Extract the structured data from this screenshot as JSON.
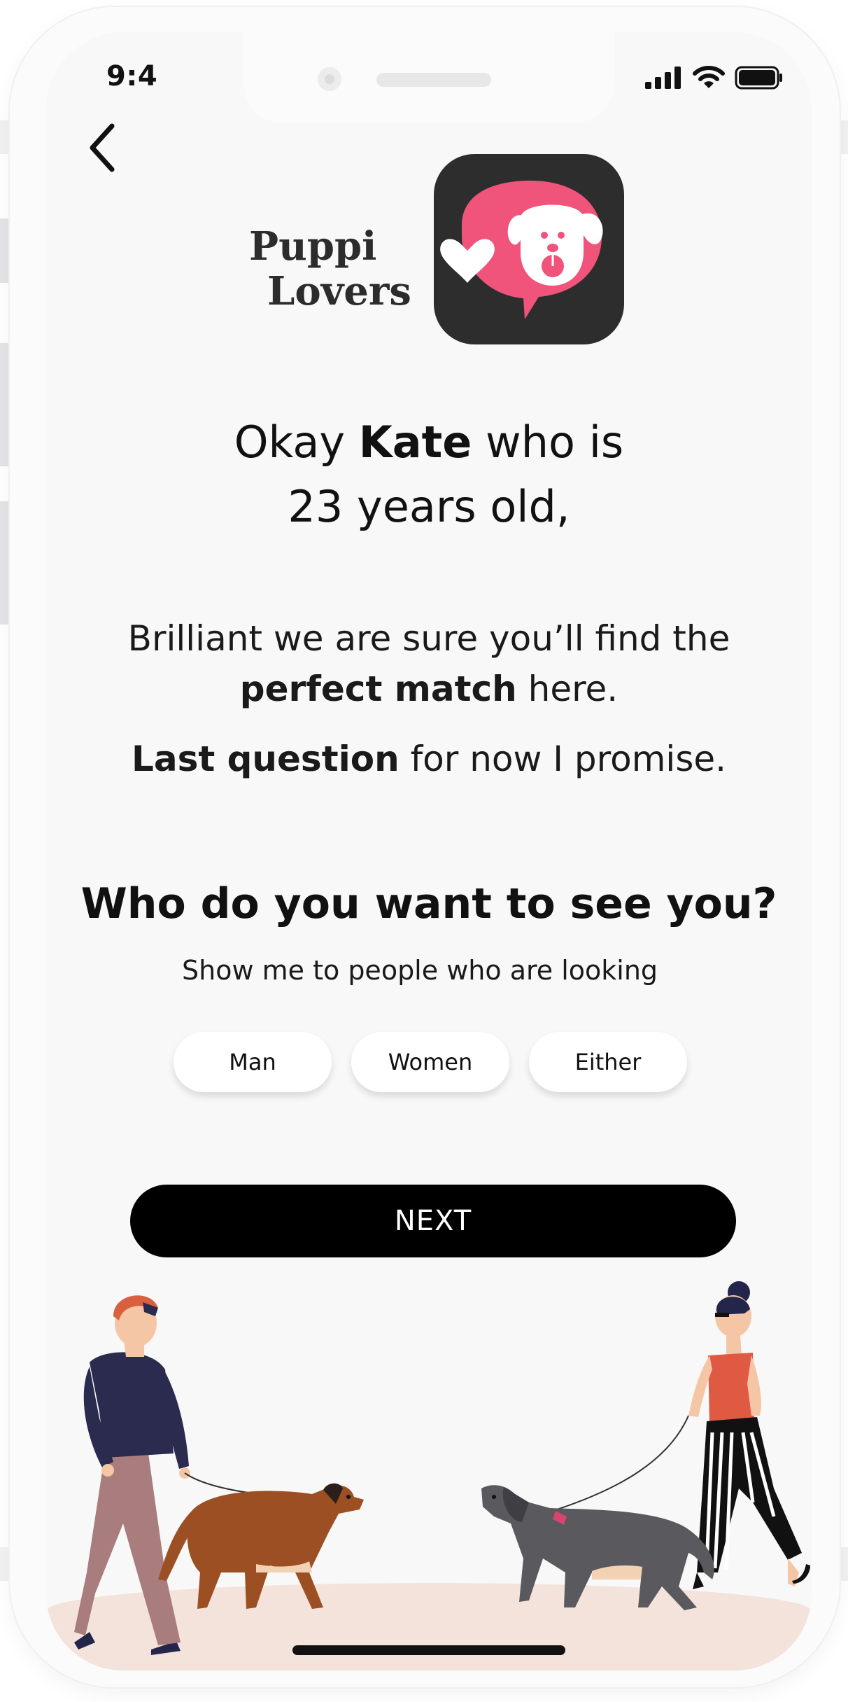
{
  "status_bar": {
    "time": "9:4"
  },
  "logo": {
    "line1": "Puppi",
    "line2": "Lovers"
  },
  "headline": {
    "prefix": "Okay ",
    "name": "Kate",
    "suffix": " who is",
    "line2": "23 years old,"
  },
  "intro": {
    "line1": "Brilliant we are sure you’ll find the",
    "bold2": "perfect match",
    "rest2": " here.",
    "bold3": "Last question",
    "rest3": " for now I promise."
  },
  "question": {
    "title": "Who do you want to see you?",
    "subtitle": "Show me to people who are looking"
  },
  "options": [
    "Man",
    "Women",
    "Either"
  ],
  "next_label": "NEXT",
  "colors": {
    "accent": "#f0547a",
    "icon_bg": "#2d2d2d",
    "button": "#000000"
  }
}
